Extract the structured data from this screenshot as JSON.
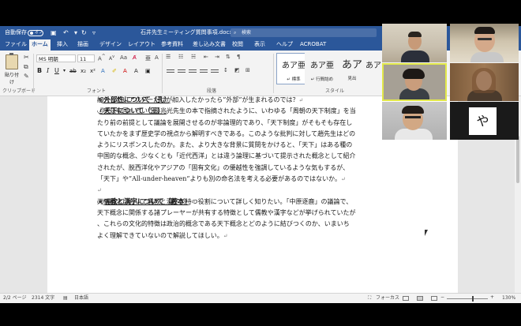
{
  "word": {
    "titlebar": {
      "autosave_label": "自動保存",
      "autosave_state": "オフ",
      "doc_title": "石井先生ミーティング質問事項.docx - Word",
      "search_placeholder": "検索"
    },
    "tabs": [
      "ファイル",
      "ホーム",
      "挿入",
      "描画",
      "デザイン",
      "レイアウト",
      "参考資料",
      "差し込み文書",
      "校閲",
      "表示",
      "ヘルプ",
      "ACROBAT"
    ],
    "active_tab": "ホーム",
    "ribbon": {
      "paste_label": "貼り付け",
      "font_name": "MS 明朝",
      "font_size": "11",
      "clipboard_label": "クリップボード",
      "font_group_label": "フォント",
      "paragraph_group_label": "段落",
      "styles_group_label": "スタイル",
      "styles": [
        {
          "preview": "あア亜",
          "name": "↵ 標準"
        },
        {
          "preview": "あア亜",
          "name": "↵ 行間詰め"
        },
        {
          "preview": "あア",
          "name": "見出"
        },
        {
          "preview": "あア",
          "name": ""
        }
      ]
    },
    "document_lines": [
      {
        "text": "⑥外部性について（孔）",
        "mark": "↵",
        "heading": true
      },
      {
        "text": "加入したいアクターだけが加入したかったら”外部”が生まれるのでは？",
        "mark": "↵",
        "heading": false
      },
      {
        "text": "⑦天下について（王）",
        "mark": "↵",
        "heading": true
      },
      {
        "text": "『宅茲中国』という葛兆光先生の本で指摘されたように、いわゆる「周朝の天下制度」を当",
        "mark": "",
        "heading": false
      },
      {
        "text": "たり前の前提として議論を展開させるのが非論理的であり、「天下制度」がそもそも存在し",
        "mark": "",
        "heading": false
      },
      {
        "text": "ていたかをまず歴史学の視点から解明すべきである。このような批判に対して趙先生はどの",
        "mark": "",
        "heading": false
      },
      {
        "text": "ようにリスポンスしたのか。また、より大きな背景に質問をかけると、「天下」はある種の",
        "mark": "",
        "heading": false
      },
      {
        "text": "中国的な概念、少なくとも「近代西洋」とは違う論理に基づいて提示された概念として紹介",
        "mark": "",
        "heading": false
      },
      {
        "text": "されたが、脱西洋化やアジアの「固有文化」の優越性を強調しているような気もするが、",
        "mark": "",
        "heading": false
      },
      {
        "text": "「天下」や”All-under-heaven”よりも別の命名法を考える必要があるのではないか。",
        "mark": "↵",
        "heading": false
      },
      {
        "text": "",
        "mark": "↵",
        "heading": false
      },
      {
        "text": "⑧儒教と漢字について（藪本）",
        "mark": "↵",
        "heading": true
      },
      {
        "text": "天下概念において儒教と漢字が持つ役割について詳しく知りたい。「中原逐鹿」の議論で、",
        "mark": "",
        "heading": false
      },
      {
        "text": "天下概念に関係する諸プレーヤーが共有する特徴として儒教や漢字などが挙げられていたが",
        "mark": "",
        "heading": false
      },
      {
        "text": "、これらの文化的特徴は政治的概念である天下概念とどのように結びつくのか、いまいち",
        "mark": "",
        "heading": false
      },
      {
        "text": "よく理解できていないので解説してほしい。",
        "mark": "↵",
        "heading": false
      }
    ],
    "statusbar": {
      "pages": "2/2 ページ",
      "words": "2314 文字",
      "language": "日本語",
      "focus": "フォーカス",
      "zoom": "130%"
    }
  },
  "video": {
    "tile6_avatar": "や"
  }
}
